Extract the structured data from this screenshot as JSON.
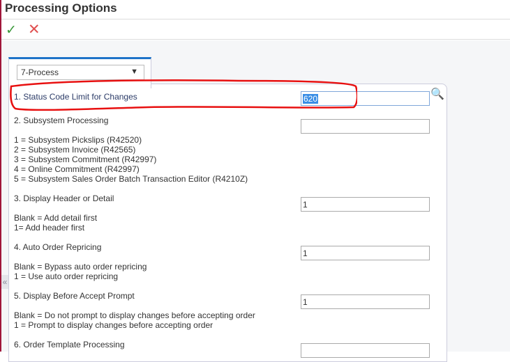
{
  "header": {
    "title": "Processing Options"
  },
  "toolbar": {
    "ok_icon": "✓",
    "cancel_icon": "✕"
  },
  "tab": {
    "selected": "7-Process",
    "arrow": "▼"
  },
  "collapse_icon": "«",
  "options": [
    {
      "label": "1. Status Code Limit for Changes",
      "value": "620",
      "desc": []
    },
    {
      "label": "2. Subsystem Processing",
      "value": "",
      "desc": [
        "1 = Subsystem Pickslips (R42520)",
        "2 = Subsystem Invoice (R42565)",
        "3 = Subsystem Commitment (R42997)",
        "4 = Online Commitment (R42997)",
        "5 = Subsystem Sales Order Batch Transaction Editor (R4210Z)"
      ]
    },
    {
      "label": "3. Display Header or Detail",
      "value": "1",
      "desc": [
        "Blank = Add detail first",
        "1= Add header first"
      ]
    },
    {
      "label": "4. Auto Order Repricing",
      "value": "1",
      "desc": [
        "Blank = Bypass auto order repricing",
        "1 = Use auto order repricing"
      ]
    },
    {
      "label": "5. Display Before Accept Prompt",
      "value": "1",
      "desc": [
        "Blank = Do not prompt to display changes before accepting order",
        "1 = Prompt to display changes before accepting order"
      ]
    },
    {
      "label": "6. Order Template Processing",
      "value": "",
      "desc": []
    }
  ]
}
